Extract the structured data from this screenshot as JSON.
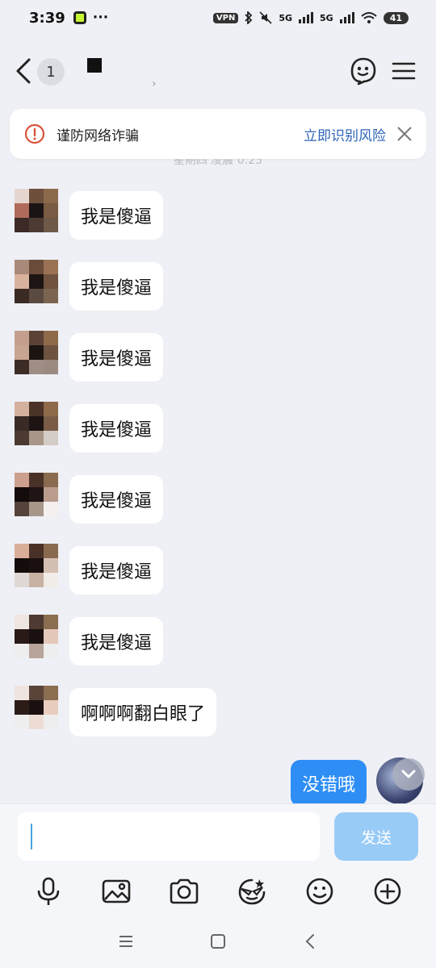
{
  "status_bar": {
    "time": "3:39",
    "dots": "···",
    "vpn": "VPN",
    "net1": "5G",
    "net2": "5G",
    "battery": "41"
  },
  "header": {
    "unread_count": "1",
    "subtitle_chevron": "›"
  },
  "warning": {
    "text": "谨防网络诈骗",
    "action": "立即识别风险"
  },
  "timestamp": "星期四 凌晨 0:25",
  "messages": [
    {
      "text": "我是傻逼",
      "avatar_colors": [
        "#e6d6d0",
        "#6e4f3c",
        "#8b6a4c",
        "#b06a5c",
        "#1b1414",
        "#7a5b43",
        "#3b2a25",
        "#4c3a33",
        "#6e5848"
      ]
    },
    {
      "text": "我是傻逼",
      "avatar_colors": [
        "#a98a7a",
        "#6a4a38",
        "#9a7253",
        "#d9b29d",
        "#1d1514",
        "#6f533f",
        "#3a2a24",
        "#5b4a41",
        "#7b6550"
      ]
    },
    {
      "text": "我是傻逼",
      "avatar_colors": [
        "#c49f8d",
        "#5c4236",
        "#8e6a4b",
        "#c8a590",
        "#1c1410",
        "#6e5340",
        "#3d2c25",
        "#a08e86",
        "#9a8a80"
      ]
    },
    {
      "text": "我是傻逼",
      "avatar_colors": [
        "#d4b09f",
        "#4b3328",
        "#8e6a4b",
        "#3a2a25",
        "#1d1312",
        "#7a5c46",
        "#4a3a32",
        "#a89688",
        "#d4ccc6"
      ]
    },
    {
      "text": "我是傻逼",
      "avatar_colors": [
        "#cca08c",
        "#4a3127",
        "#8a6b4f",
        "#140b0b",
        "#201414",
        "#b99c8c",
        "#55443c",
        "#a8968a",
        "#f5f0ee"
      ]
    },
    {
      "text": "我是傻逼",
      "avatar_colors": [
        "#d8ae99",
        "#4a3128",
        "#8a6a4f",
        "#130c0b",
        "#1a1010",
        "#d4c0b2",
        "#e0d8d4",
        "#c8b2a4",
        "#f2ece8"
      ]
    },
    {
      "text": "我是傻逼",
      "avatar_colors": [
        "#efe6e2",
        "#4e3a32",
        "#8b6d50",
        "#2a1a17",
        "#1a1010",
        "#e4c8ba",
        "#eeeeee",
        "#b8a49a",
        "#eeeeee"
      ]
    },
    {
      "text": "啊啊啊翻白眼了",
      "avatar_colors": [
        "#f0e4e0",
        "#5a443a",
        "#8b6d50",
        "#2c1c18",
        "#1a1010",
        "#e8cdbf",
        "#eeeeee",
        "#ecdcd4",
        "#eeeeee"
      ]
    }
  ],
  "my_message": "没错哦",
  "composer": {
    "send_label": "发送"
  },
  "icons": [
    "back-icon",
    "face-icon",
    "menu-icon",
    "warning-icon",
    "close-icon",
    "microphone-icon",
    "image-icon",
    "camera-icon",
    "sticker-icon",
    "emoji-icon",
    "plus-icon",
    "chevron-down-icon"
  ]
}
